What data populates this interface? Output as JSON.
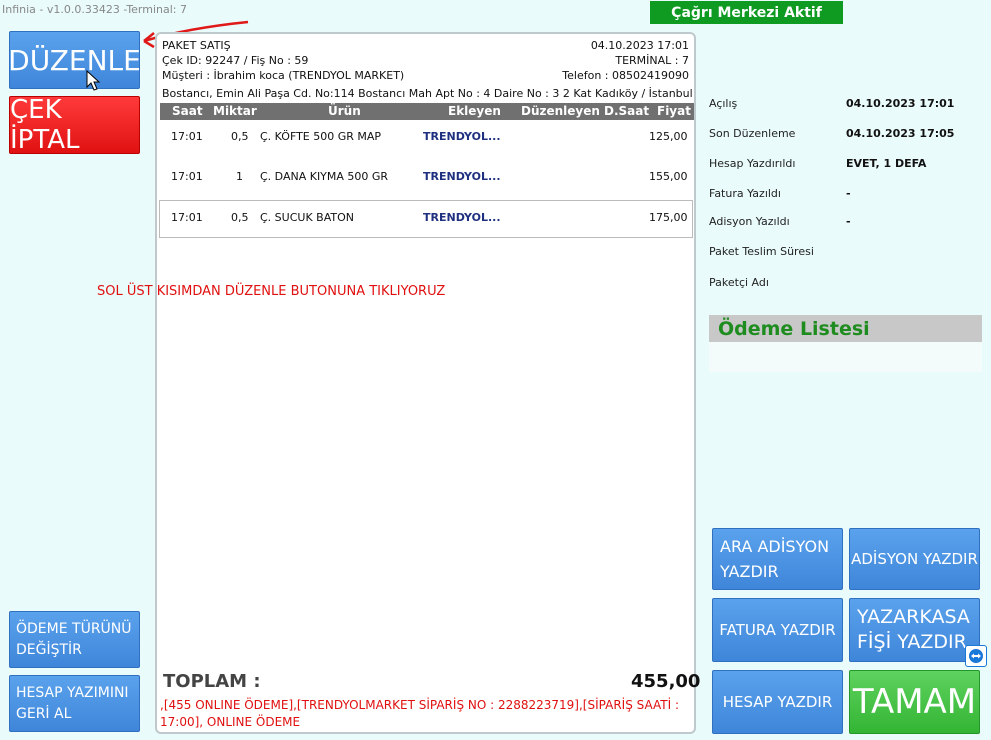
{
  "window": {
    "title": "Infinia - v1.0.0.33423 -Terminal: 7"
  },
  "status": {
    "call_center": "Çağrı Merkezi Aktif"
  },
  "left_buttons": {
    "duzenle": "DÜZENLE",
    "cek_iptal": "ÇEK İPTAL",
    "odeme_turu_line1": "ÖDEME TÜRÜNÜ",
    "odeme_turu_line2": "DEĞİŞTİR",
    "hesap_geri_line1": "HESAP YAZIMINI",
    "hesap_geri_line2": "GERİ AL"
  },
  "receipt": {
    "type": "PAKET SATIŞ",
    "datetime": "04.10.2023 17:01",
    "check_info": "Çek ID: 92247 / Fiş No : 59",
    "terminal": "TERMİNAL : 7",
    "customer": "Müşteri : İbrahim koca (TRENDYOL MARKET)",
    "phone": "Telefon : 08502419090",
    "address": "Bostancı,  Emin Ali Paşa Cd. No:114  Bostancı Mah Apt No : 4 Daire No : 3 2 Kat Kadıköy / İstanbul",
    "columns": {
      "saat": "Saat",
      "miktar": "Miktar",
      "urun": "Ürün",
      "ekleyen": "Ekleyen",
      "duzenleyen": "Düzenleyen",
      "dsaat": "D.Saat",
      "fiyat": "Fiyat"
    },
    "items": [
      {
        "saat": "17:01",
        "miktar": "0,5",
        "urun": "Ç. KÖFTE 500 GR MAP",
        "ekleyen": "TRENDYOL...",
        "fiyat": "125,00"
      },
      {
        "saat": "17:01",
        "miktar": "1",
        "urun": "Ç. DANA KIYMA 500 GR",
        "ekleyen": "TRENDYOL...",
        "fiyat": "155,00"
      },
      {
        "saat": "17:01",
        "miktar": "0,5",
        "urun": "Ç. SUCUK BATON",
        "ekleyen": "TRENDYOL...",
        "fiyat": "175,00"
      }
    ],
    "total_label": "TOPLAM :",
    "total_value": "455,00",
    "note": ",[455 ONLINE ÖDEME],[TRENDYOLMARKET SİPARİŞ NO : 2288223719],[SİPARİŞ SAATİ : 17:00], ONLINE ÖDEME"
  },
  "annotation": "SOL ÜST KISIMDAN DÜZENLE BUTONUNA TIKLIYORUZ",
  "info": {
    "acilis_label": "Açılış",
    "acilis_value": "04.10.2023 17:01",
    "son_label": "Son Düzenleme",
    "son_value": "04.10.2023 17:05",
    "hesap_label": "Hesap Yazdırıldı",
    "hesap_value": "EVET, 1 DEFA",
    "fatura_label": "Fatura Yazıldı",
    "fatura_value": "-",
    "adisyon_label": "Adisyon Yazıldı",
    "adisyon_value": "-",
    "teslim_label": "Paket Teslim Süresi",
    "paketci_label": "Paketçi Adı"
  },
  "odeme_listesi": "Ödeme Listesi",
  "right_buttons": {
    "ara_line1": "ARA ADİSYON",
    "ara_line2": "YAZDIR",
    "adisyon": "ADİSYON YAZDIR",
    "fatura": "FATURA YAZDIR",
    "yazarkasa_line1": "YAZARKASA",
    "yazarkasa_line2": "FİŞİ YAZDIR",
    "hesap": "HESAP YAZDIR",
    "tamam": "TAMAM"
  },
  "colors": {
    "status_green": "#0f9a21",
    "button_blue": "#3f86da",
    "button_red": "#e01212",
    "button_green": "#33b533",
    "annotation_red": "#e01010"
  }
}
